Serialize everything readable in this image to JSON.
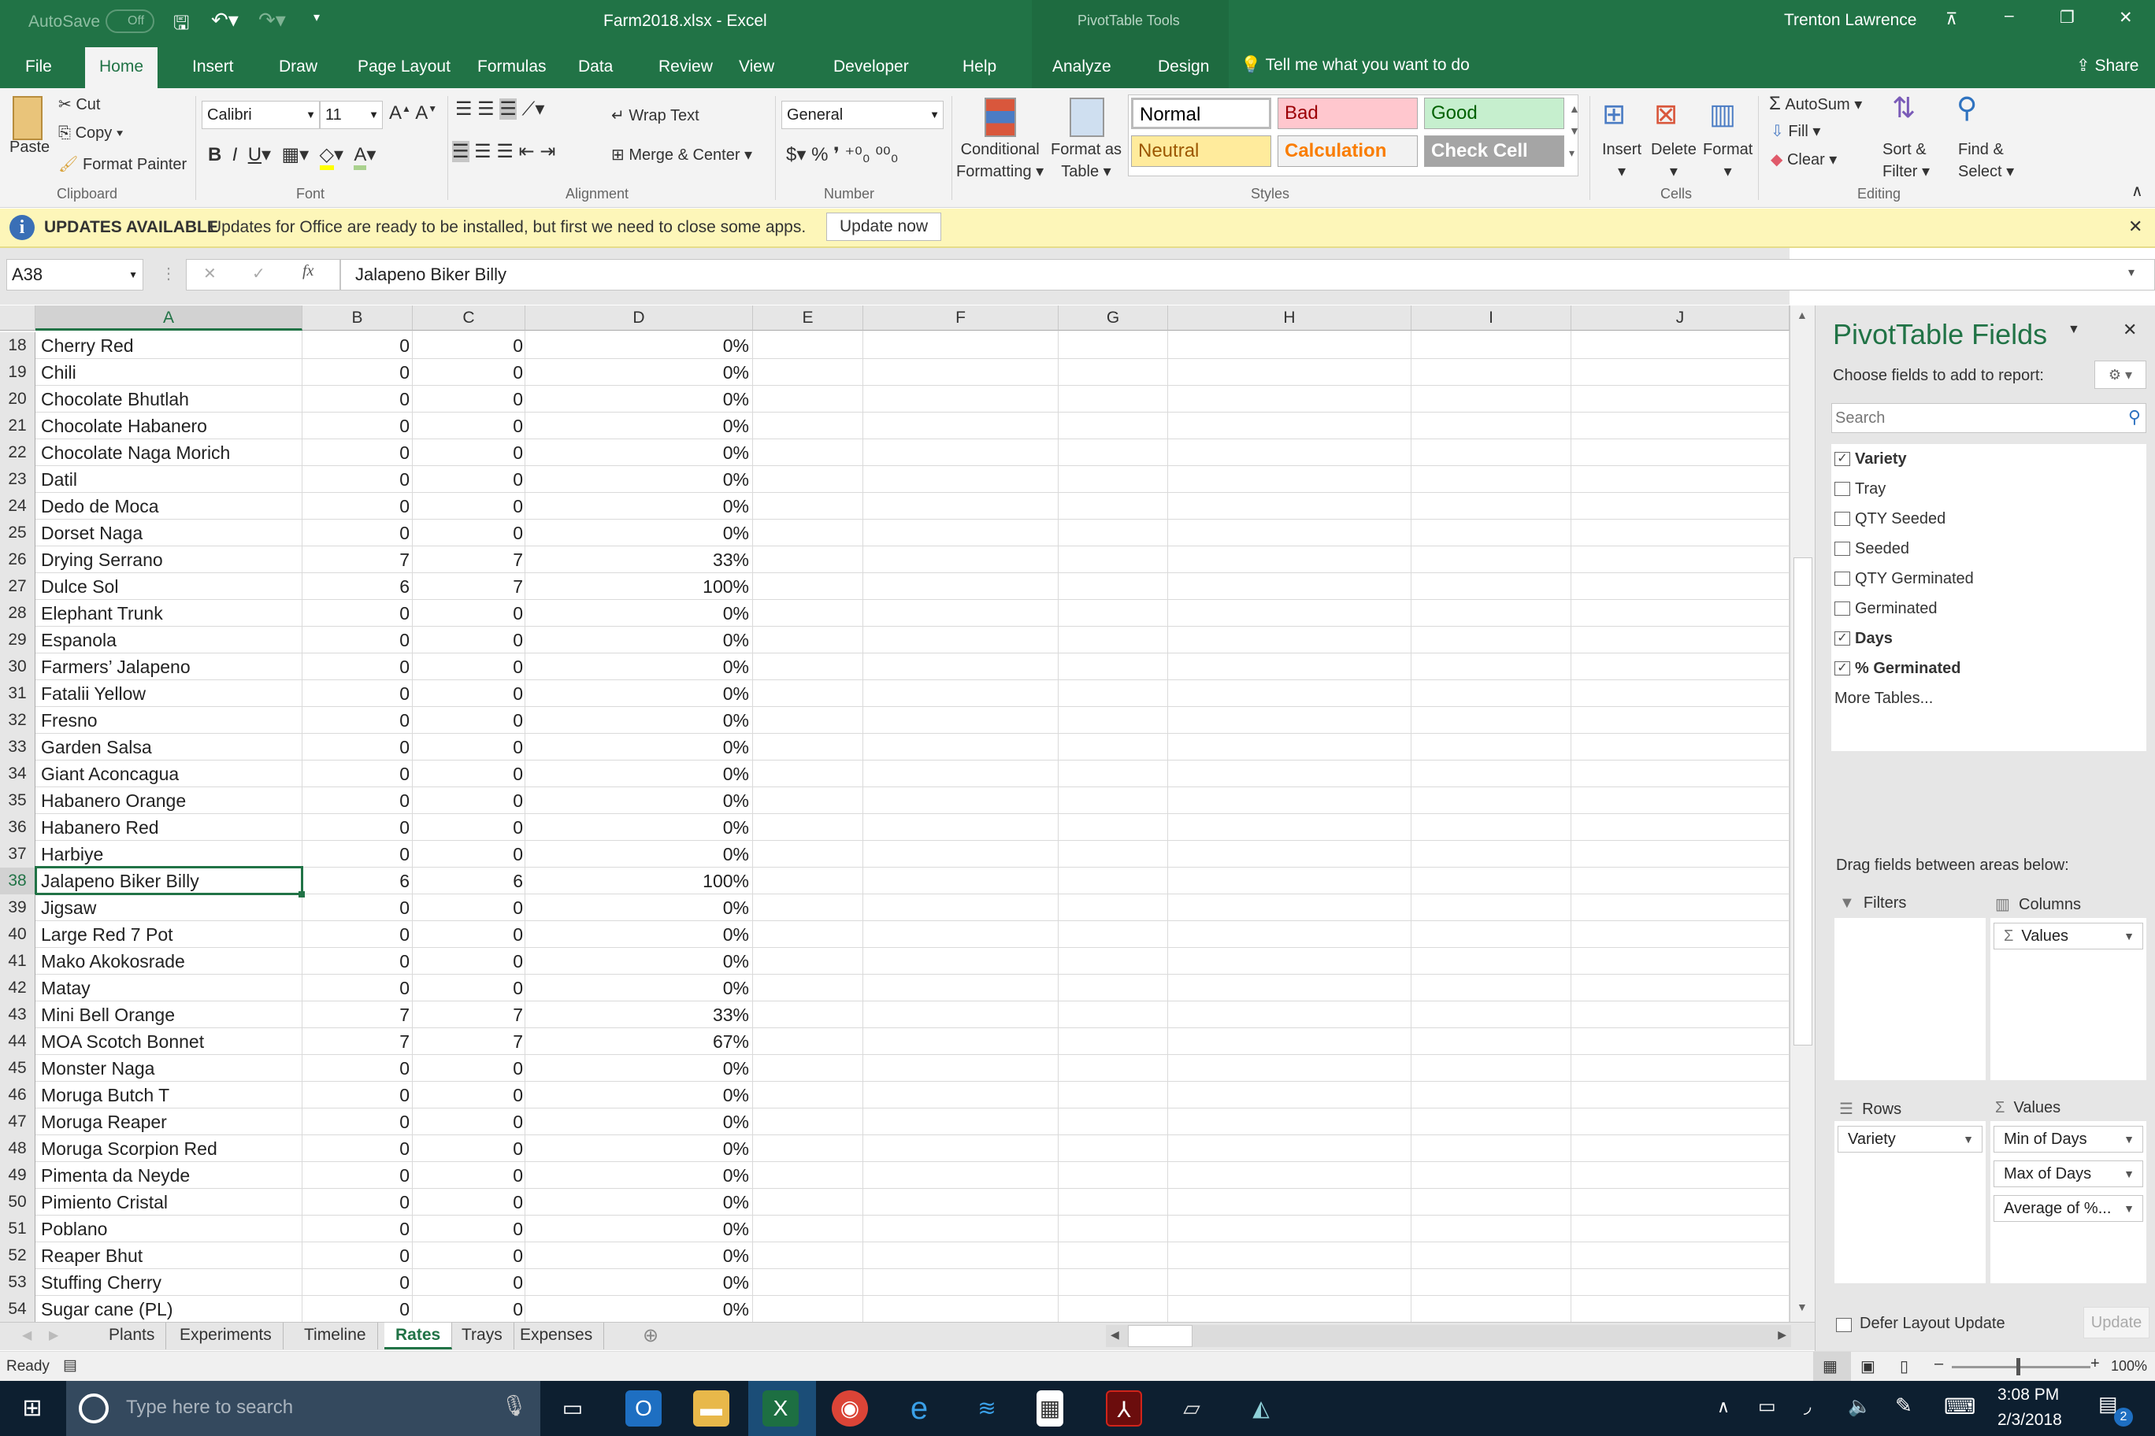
{
  "titlebar": {
    "autosave": "AutoSave",
    "autosave_state": "Off",
    "title": "Farm2018.xlsx  -  Excel",
    "context_tools": "PivotTable Tools",
    "user": "Trenton Lawrence",
    "share": "Share",
    "tell_me": "Tell me what you want to do"
  },
  "tabs": [
    "File",
    "Home",
    "Insert",
    "Draw",
    "Page Layout",
    "Formulas",
    "Data",
    "Review",
    "View",
    "Developer",
    "Help",
    "Analyze",
    "Design"
  ],
  "ribbon": {
    "paste": "Paste",
    "cut": "Cut",
    "copy": "Copy",
    "format_painter": "Format Painter",
    "clipboard": "Clipboard",
    "font_name": "Calibri",
    "font_size": "11",
    "font": "Font",
    "wrap_text": "Wrap Text",
    "merge_center": "Merge & Center",
    "alignment": "Alignment",
    "number_format": "General",
    "number": "Number",
    "conditional_formatting": [
      "Conditional",
      "Formatting"
    ],
    "format_as_table": [
      "Format as",
      "Table"
    ],
    "styles_label": "Styles",
    "styles": [
      {
        "label": "Normal",
        "bg": "#ffffff",
        "fg": "#000000"
      },
      {
        "label": "Bad",
        "bg": "#ffc7ce",
        "fg": "#9c0006"
      },
      {
        "label": "Good",
        "bg": "#c6efce",
        "fg": "#006100"
      },
      {
        "label": "Neutral",
        "bg": "#ffeb9c",
        "fg": "#9c5700"
      },
      {
        "label": "Calculation",
        "bg": "#f2f2f2",
        "fg": "#fa7d00"
      },
      {
        "label": "Check Cell",
        "bg": "#a5a5a5",
        "fg": "#ffffff"
      }
    ],
    "insert": "Insert",
    "delete": "Delete",
    "format": "Format",
    "cells": "Cells",
    "autosum": "AutoSum",
    "fill": "Fill",
    "clear": "Clear",
    "sort_filter": [
      "Sort &",
      "Filter"
    ],
    "find_select": [
      "Find &",
      "Select"
    ],
    "editing": "Editing"
  },
  "update_bar": {
    "title": "UPDATES AVAILABLE",
    "message": "Updates for Office are ready to be installed, but first we need to close some apps.",
    "button": "Update now"
  },
  "formula_bar": {
    "name_box": "A38",
    "formula": "Jalapeno Biker Billy"
  },
  "columns": [
    "A",
    "B",
    "C",
    "D",
    "E",
    "F",
    "G",
    "H",
    "I",
    "J"
  ],
  "selected_row": 38,
  "rows": [
    [
      18,
      "Cherry Red",
      "0",
      "0",
      "0%"
    ],
    [
      19,
      "Chili",
      "0",
      "0",
      "0%"
    ],
    [
      20,
      "Chocolate Bhutlah",
      "0",
      "0",
      "0%"
    ],
    [
      21,
      "Chocolate Habanero",
      "0",
      "0",
      "0%"
    ],
    [
      22,
      "Chocolate Naga Morich",
      "0",
      "0",
      "0%"
    ],
    [
      23,
      "Datil",
      "0",
      "0",
      "0%"
    ],
    [
      24,
      "Dedo de Moca",
      "0",
      "0",
      "0%"
    ],
    [
      25,
      "Dorset Naga",
      "0",
      "0",
      "0%"
    ],
    [
      26,
      "Drying Serrano",
      "7",
      "7",
      "33%"
    ],
    [
      27,
      "Dulce Sol",
      "6",
      "7",
      "100%"
    ],
    [
      28,
      "Elephant Trunk",
      "0",
      "0",
      "0%"
    ],
    [
      29,
      "Espanola",
      "0",
      "0",
      "0%"
    ],
    [
      30,
      "Farmers’ Jalapeno",
      "0",
      "0",
      "0%"
    ],
    [
      31,
      "Fatalii Yellow",
      "0",
      "0",
      "0%"
    ],
    [
      32,
      "Fresno",
      "0",
      "0",
      "0%"
    ],
    [
      33,
      "Garden Salsa",
      "0",
      "0",
      "0%"
    ],
    [
      34,
      "Giant Aconcagua",
      "0",
      "0",
      "0%"
    ],
    [
      35,
      "Habanero Orange",
      "0",
      "0",
      "0%"
    ],
    [
      36,
      "Habanero Red",
      "0",
      "0",
      "0%"
    ],
    [
      37,
      "Harbiye",
      "0",
      "0",
      "0%"
    ],
    [
      38,
      "Jalapeno Biker Billy",
      "6",
      "6",
      "100%"
    ],
    [
      39,
      "Jigsaw",
      "0",
      "0",
      "0%"
    ],
    [
      40,
      "Large Red 7 Pot",
      "0",
      "0",
      "0%"
    ],
    [
      41,
      "Mako Akokosrade",
      "0",
      "0",
      "0%"
    ],
    [
      42,
      "Matay",
      "0",
      "0",
      "0%"
    ],
    [
      43,
      "Mini Bell Orange",
      "7",
      "7",
      "33%"
    ],
    [
      44,
      "MOA Scotch Bonnet",
      "7",
      "7",
      "67%"
    ],
    [
      45,
      "Monster Naga",
      "0",
      "0",
      "0%"
    ],
    [
      46,
      "Moruga Butch T",
      "0",
      "0",
      "0%"
    ],
    [
      47,
      "Moruga Reaper",
      "0",
      "0",
      "0%"
    ],
    [
      48,
      "Moruga Scorpion Red",
      "0",
      "0",
      "0%"
    ],
    [
      49,
      "Pimenta da Neyde",
      "0",
      "0",
      "0%"
    ],
    [
      50,
      "Pimiento Cristal",
      "0",
      "0",
      "0%"
    ],
    [
      51,
      "Poblano",
      "0",
      "0",
      "0%"
    ],
    [
      52,
      "Reaper Bhut",
      "0",
      "0",
      "0%"
    ],
    [
      53,
      "Stuffing Cherry",
      "0",
      "0",
      "0%"
    ],
    [
      54,
      "Sugar cane (PL)",
      "0",
      "0",
      "0%"
    ]
  ],
  "pivot": {
    "title": "PivotTable Fields",
    "choose": "Choose fields to add to report:",
    "search_placeholder": "Search",
    "fields": [
      {
        "label": "Variety",
        "checked": true
      },
      {
        "label": "Tray",
        "checked": false
      },
      {
        "label": "QTY Seeded",
        "checked": false
      },
      {
        "label": "Seeded",
        "checked": false
      },
      {
        "label": "QTY Germinated",
        "checked": false
      },
      {
        "label": "Germinated",
        "checked": false
      },
      {
        "label": "Days",
        "checked": true
      },
      {
        "label": "% Germinated",
        "checked": true
      }
    ],
    "more_tables": "More Tables...",
    "drag_hint": "Drag fields between areas below:",
    "filters": "Filters",
    "columns": "Columns",
    "rows": "Rows",
    "values": "Values",
    "columns_items": [
      "Values"
    ],
    "rows_items": [
      "Variety"
    ],
    "values_items": [
      "Min of Days",
      "Max of Days",
      "Average of %..."
    ],
    "defer": "Defer Layout Update",
    "update": "Update"
  },
  "sheets": [
    "Plants",
    "Experiments",
    "Timeline",
    "Rates",
    "Trays",
    "Expenses"
  ],
  "active_sheet": "Rates",
  "status": {
    "ready": "Ready",
    "zoom": "100%"
  },
  "taskbar": {
    "search": "Type here to search",
    "time": "3:08 PM",
    "date": "2/3/2018",
    "notifications": "2"
  }
}
